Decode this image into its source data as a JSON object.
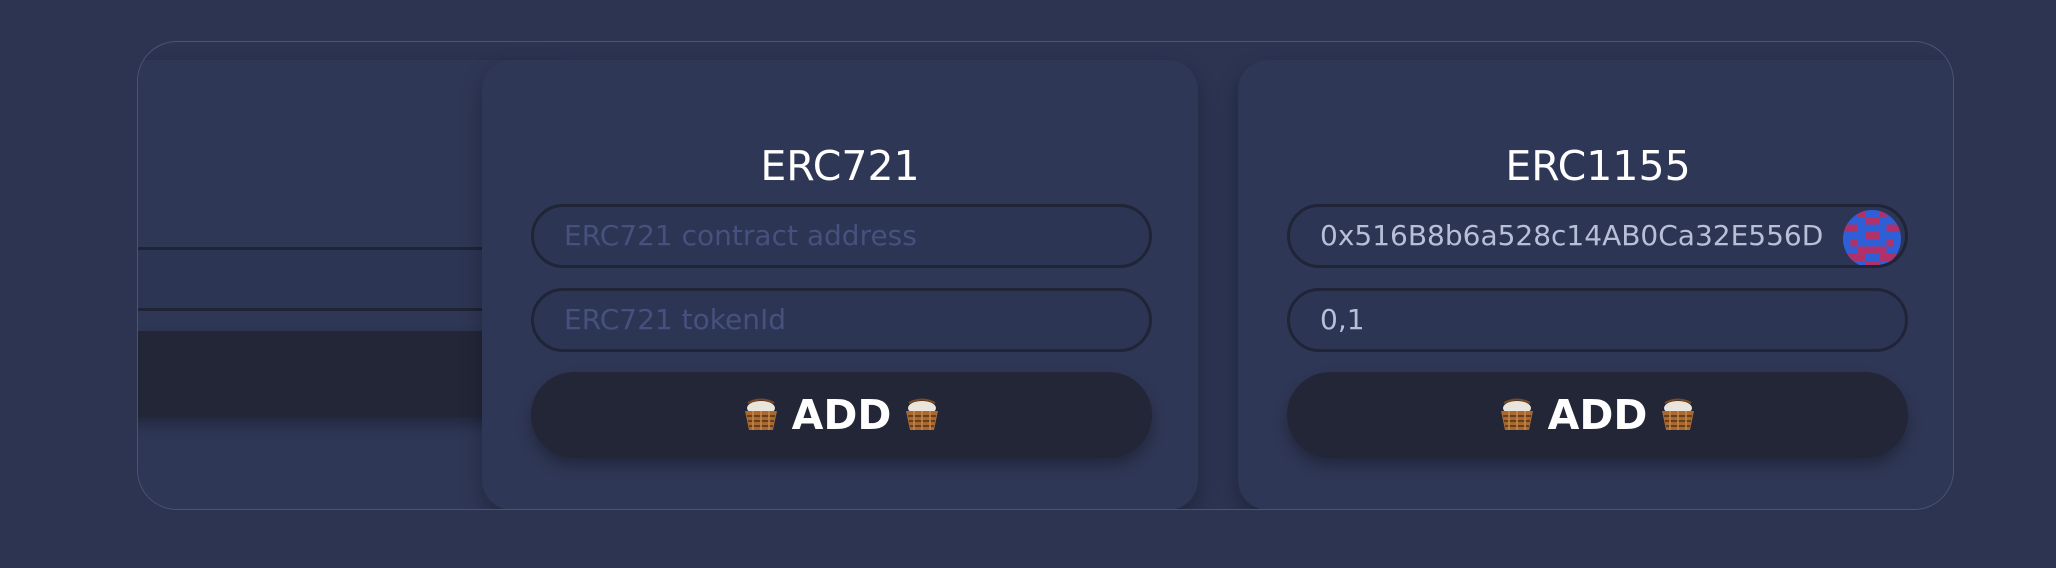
{
  "cards": {
    "partial": {
      "title_fragment": ")"
    },
    "erc721": {
      "title": "ERC721",
      "address_placeholder": "ERC721 contract address",
      "tokenid_placeholder": "ERC721 tokenId",
      "add_label": "ADD"
    },
    "erc1155": {
      "title": "ERC1155",
      "address_value": "0x516B8b6a528c14AB0Ca32E556D",
      "ids_value": "0,1",
      "add_label": "ADD"
    }
  },
  "icons": {
    "basket": "basket-icon",
    "avatar": "identicon-avatar"
  },
  "colors": {
    "background": "#2c3452",
    "card": "#2f3756",
    "button": "#232637",
    "placeholder": "#46517d"
  }
}
